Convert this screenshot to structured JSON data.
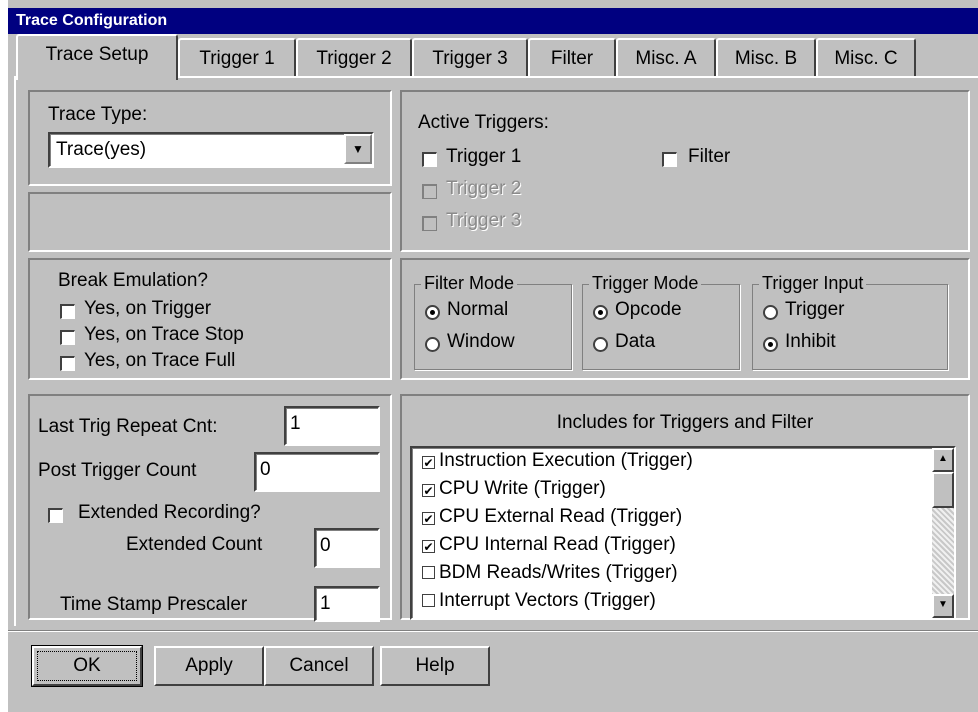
{
  "window": {
    "title": "Trace Configuration"
  },
  "tabs": [
    {
      "label": "Trace Setup"
    },
    {
      "label": "Trigger 1"
    },
    {
      "label": "Trigger 2"
    },
    {
      "label": "Trigger 3"
    },
    {
      "label": "Filter"
    },
    {
      "label": "Misc. A"
    },
    {
      "label": "Misc. B"
    },
    {
      "label": "Misc. C"
    }
  ],
  "trace_type": {
    "label": "Trace Type:",
    "value": "Trace(yes)"
  },
  "active_triggers": {
    "label": "Active Triggers:",
    "trigger1": "Trigger 1",
    "trigger2": "Trigger 2",
    "trigger3": "Trigger 3",
    "filter": "Filter"
  },
  "break_emulation": {
    "label": "Break Emulation?",
    "on_trigger": "Yes, on Trigger",
    "on_trace_stop": "Yes, on Trace Stop",
    "on_trace_full": "Yes, on Trace Full"
  },
  "filter_mode": {
    "title": "Filter Mode",
    "normal": "Normal",
    "window": "Window",
    "selected": "Normal"
  },
  "trigger_mode": {
    "title": "Trigger Mode",
    "opcode": "Opcode",
    "data": "Data",
    "selected": "Opcode"
  },
  "trigger_input": {
    "title": "Trigger Input",
    "trigger": "Trigger",
    "inhibit": "Inhibit",
    "selected": "Inhibit"
  },
  "counts": {
    "last_trig_repeat_label": "Last Trig Repeat Cnt:",
    "last_trig_repeat_value": "1",
    "post_trigger_label": "Post Trigger Count",
    "post_trigger_value": "0",
    "extended_recording_label": "Extended Recording?",
    "extended_count_label": "Extended Count",
    "extended_count_value": "0",
    "timestamp_prescaler_label": "Time Stamp Prescaler",
    "timestamp_prescaler_value": "1"
  },
  "includes": {
    "title": "Includes for Triggers and Filter",
    "items": [
      {
        "label": "Instruction Execution (Trigger)",
        "checked": true
      },
      {
        "label": "CPU Write (Trigger)",
        "checked": true
      },
      {
        "label": "CPU External Read (Trigger)",
        "checked": true
      },
      {
        "label": "CPU Internal Read (Trigger)",
        "checked": true
      },
      {
        "label": "BDM Reads/Writes (Trigger)",
        "checked": false
      },
      {
        "label": "Interrupt Vectors (Trigger)",
        "checked": false
      }
    ]
  },
  "buttons": {
    "ok": "OK",
    "apply": "Apply",
    "cancel": "Cancel",
    "help": "Help"
  }
}
